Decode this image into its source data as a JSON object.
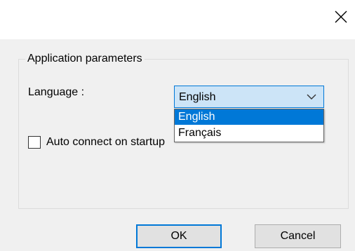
{
  "dialog": {
    "close_icon": "close-icon"
  },
  "group": {
    "title": "Application parameters"
  },
  "language": {
    "label": "Language :",
    "selected": "English",
    "options": [
      "English",
      "Français"
    ],
    "highlighted": "English"
  },
  "auto_connect": {
    "label": "Auto connect on startup",
    "checked": false
  },
  "buttons": {
    "ok": "OK",
    "cancel": "Cancel"
  },
  "colors": {
    "accent": "#0078d7",
    "combo_focus_bg": "#cce4f7",
    "window_bg": "#f0f0f0"
  }
}
